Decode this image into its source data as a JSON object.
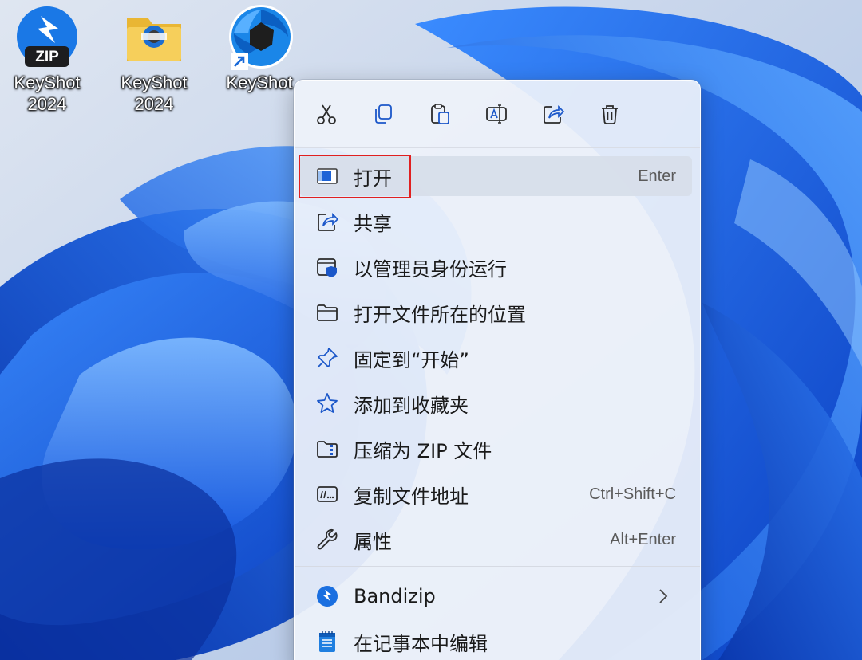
{
  "desktop": {
    "icons": [
      {
        "line1": "KeyShot",
        "line2": "2024",
        "icon": "zip-archive-icon"
      },
      {
        "line1": "KeyShot",
        "line2": "2024",
        "icon": "folder-icon"
      },
      {
        "line1": "KeyShot",
        "line2": "",
        "icon": "keyshot-app-icon",
        "shortcut": true
      }
    ]
  },
  "context_menu": {
    "toolbar": [
      {
        "name": "cut",
        "icon": "scissors-icon"
      },
      {
        "name": "copy",
        "icon": "copy-icon"
      },
      {
        "name": "paste",
        "icon": "paste-icon"
      },
      {
        "name": "rename",
        "icon": "rename-icon"
      },
      {
        "name": "share",
        "icon": "share-icon"
      },
      {
        "name": "delete",
        "icon": "trash-icon"
      }
    ],
    "items": [
      {
        "label": "打开",
        "shortcut": "Enter",
        "icon": "app-window-icon",
        "highlighted": true
      },
      {
        "label": "共享",
        "shortcut": "",
        "icon": "share-icon"
      },
      {
        "label": "以管理员身份运行",
        "shortcut": "",
        "icon": "admin-shield-icon"
      },
      {
        "label": "打开文件所在的位置",
        "shortcut": "",
        "icon": "folder-outline-icon"
      },
      {
        "label": "固定到“开始”",
        "shortcut": "",
        "icon": "pin-icon"
      },
      {
        "label": "添加到收藏夹",
        "shortcut": "",
        "icon": "star-icon"
      },
      {
        "label": "压缩为 ZIP 文件",
        "shortcut": "",
        "icon": "zip-folder-icon"
      },
      {
        "label": "复制文件地址",
        "shortcut": "Ctrl+Shift+C",
        "icon": "copy-path-icon"
      },
      {
        "label": "属性",
        "shortcut": "Alt+Enter",
        "icon": "wrench-icon"
      }
    ],
    "extra_items": [
      {
        "label": "Bandizip",
        "has_submenu": true,
        "icon": "bandizip-icon"
      },
      {
        "label": "在记事本中编辑",
        "icon": "notepad-icon"
      }
    ]
  },
  "colors": {
    "highlight_border": "#e02020",
    "accent_blue": "#0a5bd6",
    "icon_stroke": "#2b2b2b"
  }
}
